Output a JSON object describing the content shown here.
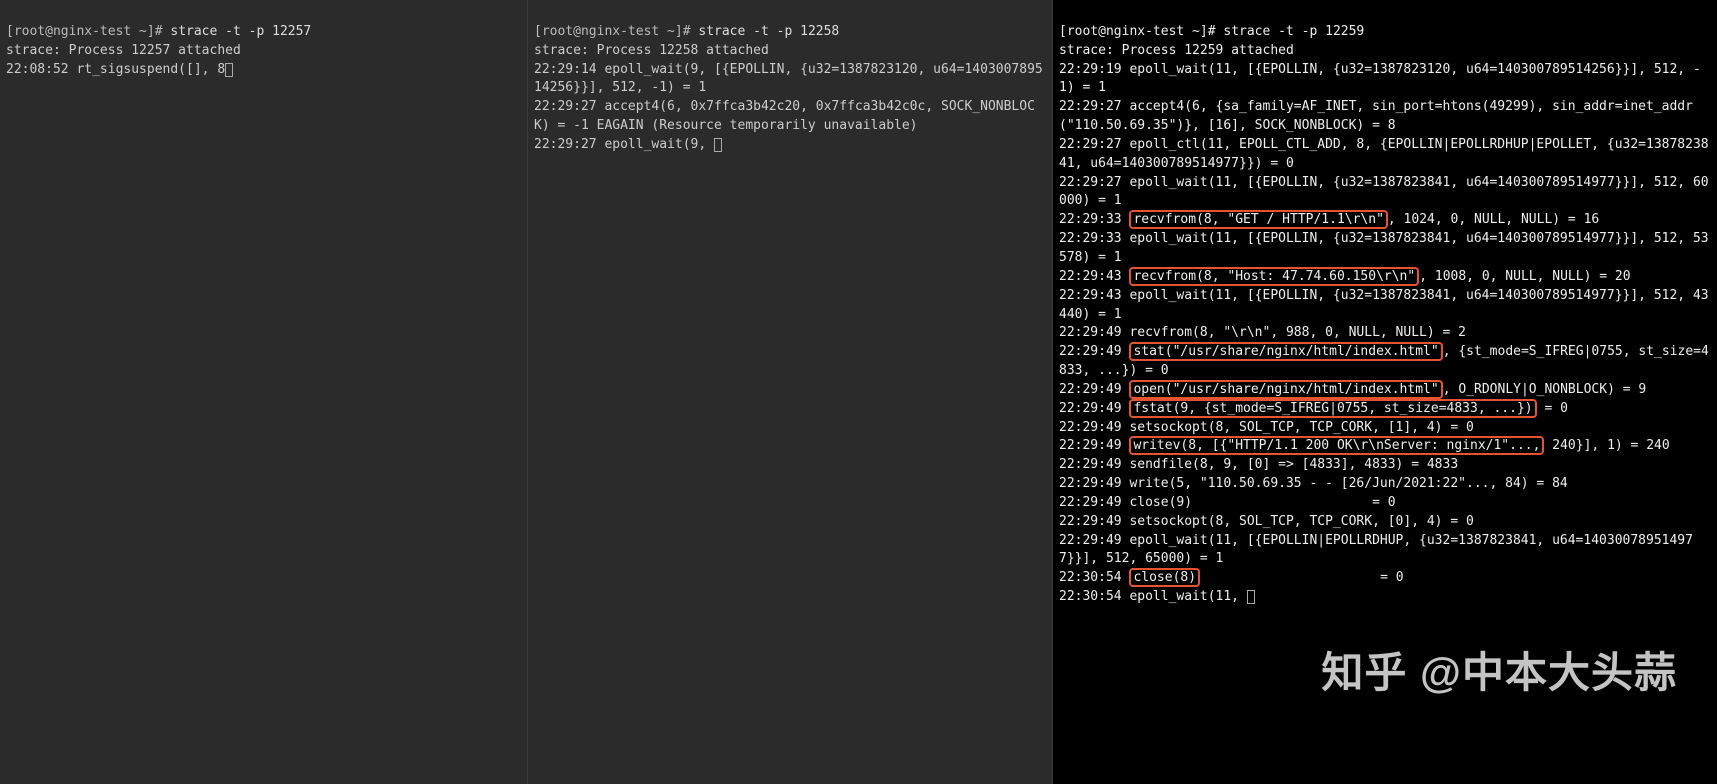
{
  "pane1": {
    "prompt": "[root@nginx-test ~]# ",
    "command": "strace -t -p 12257",
    "lines": [
      "strace: Process 12257 attached",
      "22:08:52 rt_sigsuspend([], 8"
    ]
  },
  "pane2": {
    "prompt": "[root@nginx-test ~]# ",
    "command": "strace -t -p 12258",
    "lines": [
      "strace: Process 12258 attached",
      "22:29:14 epoll_wait(9, [{EPOLLIN, {u32=1387823120, u64=140300789514256}}], 512, -1) = 1",
      "22:29:27 accept4(6, 0x7ffca3b42c20, 0x7ffca3b42c0c, SOCK_NONBLOCK) = -1 EAGAIN (Resource temporarily unavailable)",
      "22:29:27 epoll_wait(9, "
    ]
  },
  "pane3": {
    "prompt": "[root@nginx-test ~]# ",
    "command": "strace -t -p 12259",
    "segments": [
      {
        "t": "strace: Process 12259 attached\n"
      },
      {
        "t": "22:29:19 epoll_wait(11, [{EPOLLIN, {u32=1387823120, u64=140300789514256}}], 512, -1) = 1\n"
      },
      {
        "t": "22:29:27 accept4(6, {sa_family=AF_INET, sin_port=htons(49299), sin_addr=inet_addr(\"110.50.69.35\")}, [16], SOCK_NONBLOCK) = 8\n"
      },
      {
        "t": "22:29:27 epoll_ctl(11, EPOLL_CTL_ADD, 8, {EPOLLIN|EPOLLRDHUP|EPOLLET, {u32=1387823841, u64=140300789514977}}) = 0\n"
      },
      {
        "t": "22:29:27 epoll_wait(11, [{EPOLLIN, {u32=1387823841, u64=140300789514977}}], 512, 60000) = 1\n"
      },
      {
        "t": "22:29:33 "
      },
      {
        "t": "recvfrom(8, \"GET / HTTP/1.1\\r\\n\"",
        "hl": true
      },
      {
        "t": ", 1024, 0, NULL, NULL) = 16\n"
      },
      {
        "t": "22:29:33 epoll_wait(11, [{EPOLLIN, {u32=1387823841, u64=140300789514977}}], 512, 53578) = 1\n"
      },
      {
        "t": "22:29:43 "
      },
      {
        "t": "recvfrom(8, \"Host: 47.74.60.150\\r\\n\"",
        "hl": true
      },
      {
        "t": ", 1008, 0, NULL, NULL) = 20\n"
      },
      {
        "t": "22:29:43 epoll_wait(11, [{EPOLLIN, {u32=1387823841, u64=140300789514977}}], 512, 43440) = 1\n"
      },
      {
        "t": "22:29:49 recvfrom(8, \"\\r\\n\", 988, 0, NULL, NULL) = 2\n"
      },
      {
        "t": "22:29:49 "
      },
      {
        "t": "stat(\"/usr/share/nginx/html/index.html\"",
        "hl": true
      },
      {
        "t": ", {st_mode=S_IFREG|0755, st_size=4833, ...}) = 0\n"
      },
      {
        "t": "22:29:49 "
      },
      {
        "t": "open(\"/usr/share/nginx/html/index.html\"",
        "hl": true
      },
      {
        "t": ", O_RDONLY|O_NONBLOCK) = 9\n"
      },
      {
        "t": "22:29:49 "
      },
      {
        "t": "fstat(9, {st_mode=S_IFREG|0755, st_size=4833, ...})",
        "hl": true
      },
      {
        "t": " = 0\n"
      },
      {
        "t": "22:29:49 setsockopt(8, SOL_TCP, TCP_CORK, [1], 4) = 0\n"
      },
      {
        "t": "22:29:49 "
      },
      {
        "t": "writev(8, [{\"HTTP/1.1 200 OK\\r\\nServer: nginx/1\"...,",
        "hl": true
      },
      {
        "t": " 240}], 1) = 240\n"
      },
      {
        "t": "22:29:49 sendfile(8, 9, [0] => [4833], 4833) = 4833\n"
      },
      {
        "t": "22:29:49 write(5, \"110.50.69.35 - - [26/Jun/2021:22\"..., 84) = 84\n"
      },
      {
        "t": "22:29:49 close(9)                       = 0\n"
      },
      {
        "t": "22:29:49 setsockopt(8, SOL_TCP, TCP_CORK, [0], 4) = 0\n"
      },
      {
        "t": "22:29:49 epoll_wait(11, [{EPOLLIN|EPOLLRDHUP, {u32=1387823841, u64=140300789514977}}], 512, 65000) = 1\n"
      },
      {
        "t": "22:30:54 "
      },
      {
        "t": "close(8)",
        "hl": true
      },
      {
        "t": "                       = 0\n"
      },
      {
        "t": "22:30:54 epoll_wait(11, "
      }
    ]
  },
  "watermark": "知乎 @中本大头蒜"
}
